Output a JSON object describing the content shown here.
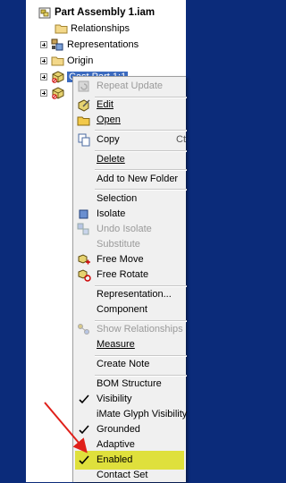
{
  "tree": {
    "root": "Part Assembly 1.iam",
    "items": [
      {
        "label": "Relationships"
      },
      {
        "label": "Representations"
      },
      {
        "label": "Origin"
      },
      {
        "label": "Cast Part 1:1"
      }
    ]
  },
  "menu": {
    "items": [
      {
        "label": "Repeat Update",
        "disabled": true
      },
      {
        "label": "Edit"
      },
      {
        "label": "Open"
      },
      {
        "label": "Copy",
        "shortcut": "Ct"
      },
      {
        "label": "Delete"
      },
      {
        "label": "Add to New Folder"
      },
      {
        "label": "Selection"
      },
      {
        "label": "Isolate"
      },
      {
        "label": "Undo Isolate",
        "disabled": true
      },
      {
        "label": "Substitute",
        "disabled": true
      },
      {
        "label": "Free Move"
      },
      {
        "label": "Free Rotate"
      },
      {
        "label": "Representation..."
      },
      {
        "label": "Component"
      },
      {
        "label": "Show Relationships",
        "disabled": true
      },
      {
        "label": "Measure"
      },
      {
        "label": "Create Note"
      },
      {
        "label": "BOM Structure"
      },
      {
        "label": "Visibility",
        "checked": true
      },
      {
        "label": "iMate Glyph Visibility"
      },
      {
        "label": "Grounded",
        "checked": true
      },
      {
        "label": "Adaptive"
      },
      {
        "label": "Enabled",
        "checked": true,
        "highlighted": true
      },
      {
        "label": "Contact Set"
      }
    ]
  },
  "colors": {
    "highlight": "#dfe03c",
    "annotation_arrow": "#e0201a",
    "panel_bg": "#0b2b7a"
  }
}
